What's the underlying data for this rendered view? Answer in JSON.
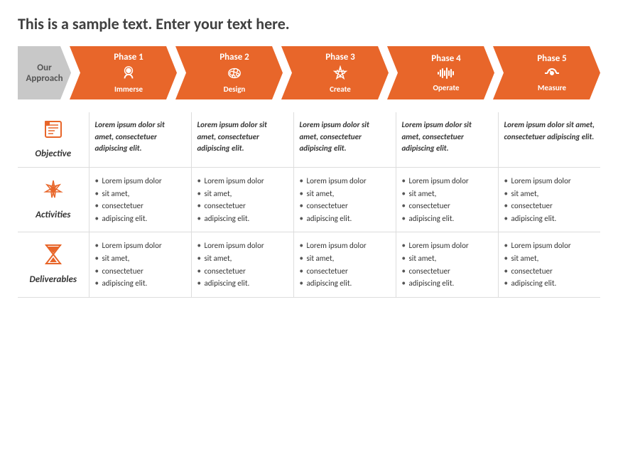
{
  "title": "This is a sample text. Enter your text here.",
  "approach_label": "Our\nApproach",
  "phases": [
    {
      "number": "Phase 1",
      "icon": "immerse",
      "name": "Immerse"
    },
    {
      "number": "Phase 2",
      "icon": "design",
      "name": "Design"
    },
    {
      "number": "Phase 3",
      "icon": "create",
      "name": "Create"
    },
    {
      "number": "Phase 4",
      "icon": "operate",
      "name": "Operate"
    },
    {
      "number": "Phase 5",
      "icon": "measure",
      "name": "Measure"
    }
  ],
  "rows": [
    {
      "id": "objective",
      "icon": "list-icon",
      "label": "Objective",
      "type": "objective",
      "cells": [
        "Lorem ipsum dolor sit amet, consectetuer adipiscing elit.",
        "Lorem ipsum dolor sit amet, consectetuer adipiscing elit.",
        "Lorem ipsum dolor sit amet, consectetuer adipiscing elit.",
        "Lorem ipsum dolor sit amet, consectetuer adipiscing elit.",
        "Lorem ipsum dolor sit amet, consectetuer adipiscing elit."
      ]
    },
    {
      "id": "activities",
      "icon": "star-icon",
      "label": "Activities",
      "type": "list",
      "cells": [
        [
          "Lorem ipsum dolor",
          "sit amet,",
          "consectetuer",
          "adipiscing elit."
        ],
        [
          "Lorem ipsum dolor",
          "sit amet,",
          "consectetuer",
          "adipiscing elit."
        ],
        [
          "Lorem ipsum dolor",
          "sit amet,",
          "consectetuer",
          "adipiscing elit."
        ],
        [
          "Lorem ipsum dolor",
          "sit amet,",
          "consectetuer",
          "adipiscing elit."
        ],
        [
          "Lorem ipsum dolor",
          "sit amet,",
          "consectetuer",
          "adipiscing elit."
        ]
      ]
    },
    {
      "id": "deliverables",
      "icon": "hourglass-icon",
      "label": "Deliverables",
      "type": "list",
      "cells": [
        [
          "Lorem ipsum dolor",
          "sit amet,",
          "consectetuer",
          "adipiscing elit."
        ],
        [
          "Lorem ipsum dolor",
          "sit amet,",
          "consectetuer",
          "adipiscing elit."
        ],
        [
          "Lorem ipsum dolor",
          "sit amet,",
          "consectetuer",
          "adipiscing elit."
        ],
        [
          "Lorem ipsum dolor",
          "sit amet,",
          "consectetuer",
          "adipiscing elit."
        ],
        [
          "Lorem ipsum dolor",
          "sit amet,",
          "consectetuer",
          "adipiscing elit."
        ]
      ]
    }
  ],
  "colors": {
    "orange": "#e8662a",
    "gray": "#c8c8c8",
    "text_dark": "#404040"
  }
}
